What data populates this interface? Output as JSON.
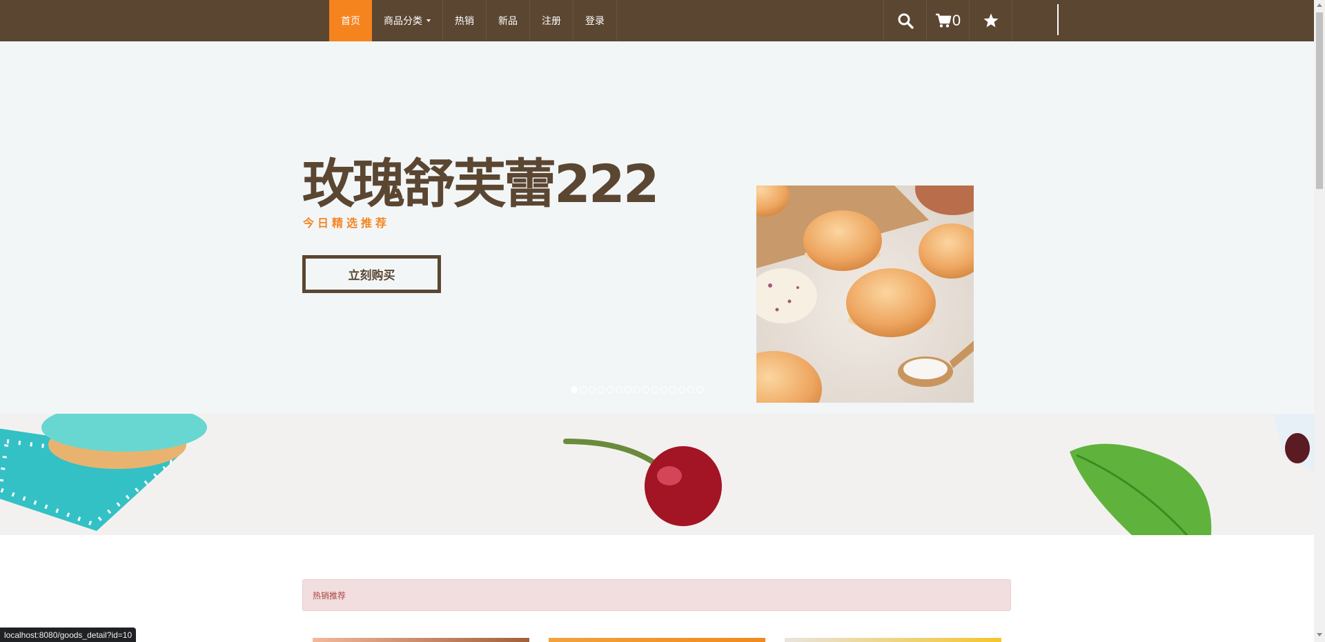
{
  "nav": {
    "items": [
      {
        "label": "首页",
        "active": true
      },
      {
        "label": "商品分类",
        "dropdown": true
      },
      {
        "label": "热销"
      },
      {
        "label": "新品"
      },
      {
        "label": "注册"
      },
      {
        "label": "登录"
      }
    ],
    "cart_count": "0",
    "icons": [
      "search-icon",
      "cart-icon",
      "star-icon"
    ]
  },
  "hero": {
    "title": "玫瑰舒芙蕾222",
    "subtitle": "今日精选推荐",
    "buy_button": "立刻购买",
    "slide_count": 15,
    "active_slide": 1
  },
  "section": {
    "hot_label": "热销推荐"
  },
  "status_bar": {
    "url": "localhost:8080/goods_detail?id=10"
  },
  "colors": {
    "nav_bg": "#5b4632",
    "accent": "#f5841f",
    "hero_bg": "#f2f6f7",
    "alert_bg": "#f2dede",
    "alert_text": "#a94442"
  }
}
